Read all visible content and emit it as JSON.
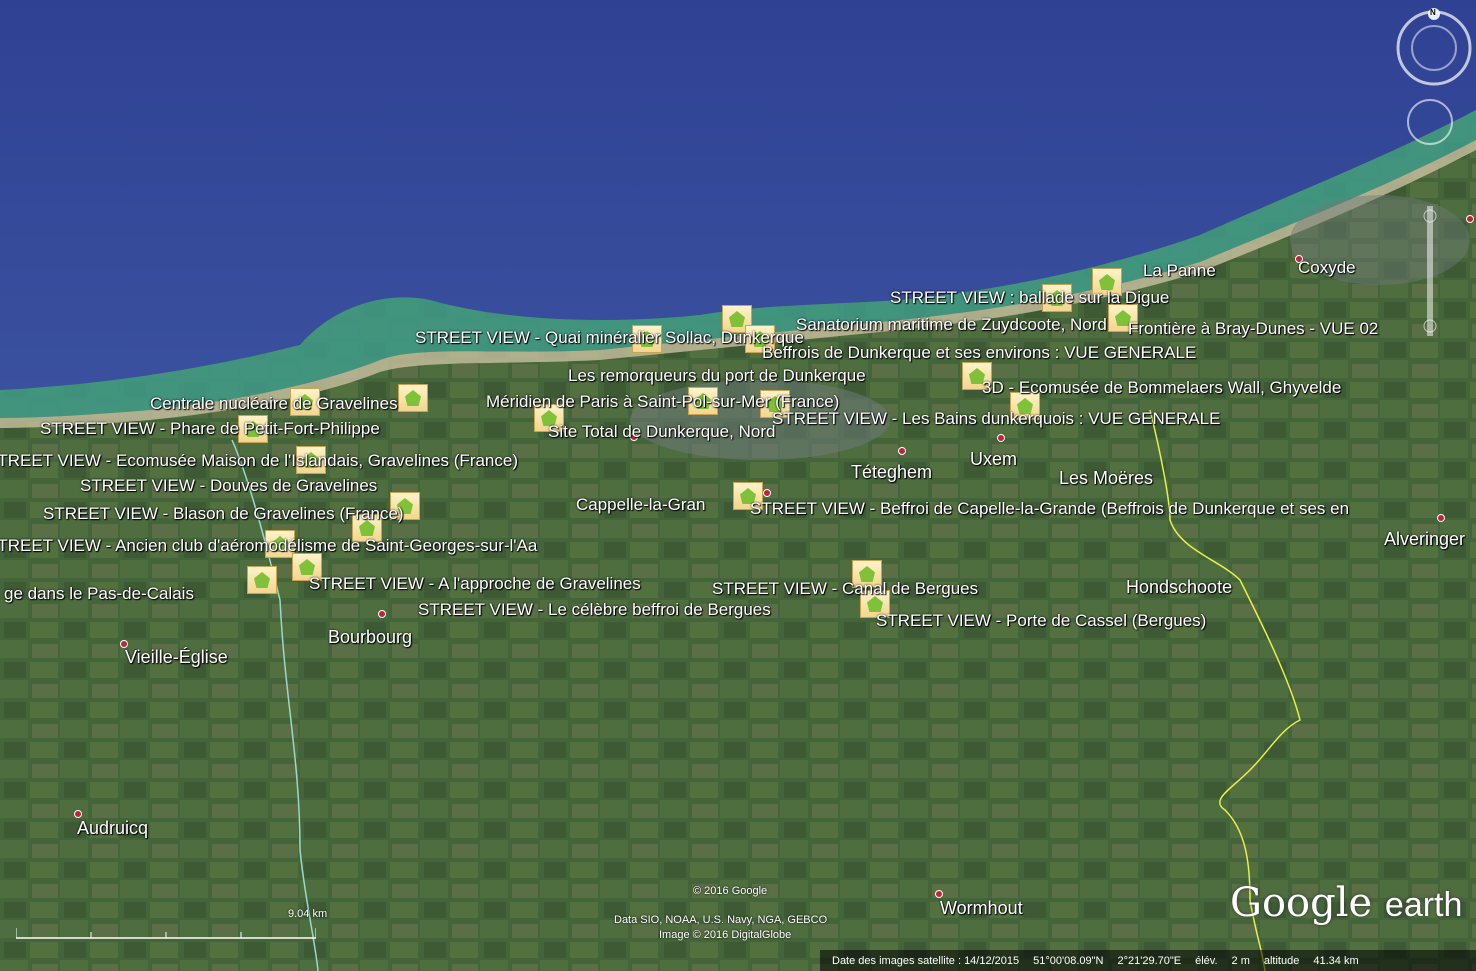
{
  "colors": {
    "sea": "#34489a",
    "coast": "#3e9a8a",
    "land": "#44643a",
    "border_fr": "#9ad9c9",
    "border_be": "#e8f04a"
  },
  "map_labels": [
    "STREET VIEW : ballade sur la Digue",
    "Sanatorium maritime de Zuydcoote, Nord",
    "Frontière à Bray-Dunes - VUE 02",
    "STREET VIEW - Quai minéralier Sollac, Dunkerque",
    "Beffrois de Dunkerque et ses environs : VUE GENERALE",
    "Les remorqueurs du port de Dunkerque",
    "3D - Ecomusée de Bommelaers Wall, Ghyvelde",
    "Centrale nucléaire de Gravelines",
    "Méridien de Paris à Saint-Pol-sur-Mer (France)",
    "STREET VIEW - Les Bains dunkerquois : VUE GENERALE",
    "STREET VIEW - Phare de Petit-Fort-Philippe",
    "Site Total de Dunkerque, Nord",
    "STREET VIEW - Ecomusée Maison de l'Islandais, Gravelines (France)",
    "STREET VIEW - Douves de Gravelines",
    "STREET VIEW - Blason de Gravelines (France)",
    "STREET VIEW - Beffroi de Capelle-la-Grande (Beffrois de Dunkerque et ses en",
    "STREET VIEW - Ancien club d'aéromodélisme de Saint-Georges-sur-l'Aa",
    "STREET VIEW - A l'approche de Gravelines",
    "STREET VIEW - Canal de Bergues",
    "ge dans le Pas-de-Calais",
    "STREET VIEW - Le célèbre beffroi de Bergues",
    "STREET VIEW - Porte de Cassel (Bergues)"
  ],
  "towns": [
    "La Panne",
    "Coxyde",
    "Téteghem",
    "Uxem",
    "Les Moëres",
    "Cappelle-la-Gran",
    "Alveringer",
    "Hondschoote",
    "Bourbourg",
    "Vieille-Église",
    "Audruicq",
    "Wormhout"
  ],
  "credits": {
    "copyright": "© 2016 Google",
    "data": "Data SIO, NOAA, U.S. Navy, NGA, GEBCO",
    "image": "Image © 2016 DigitalGlobe"
  },
  "scale_label": "9.04 km",
  "status": {
    "date": "Date des images satellite : 14/12/2015",
    "lat": "51°00'08.09\"N",
    "lon": "2°21'29.70\"E",
    "elev_label": "élév.",
    "elev": "2 m",
    "alt_label": "altitude",
    "alt": "41.34 km"
  },
  "logo": {
    "word1": "Google",
    "word2": "earth"
  },
  "compass_letter": "N"
}
